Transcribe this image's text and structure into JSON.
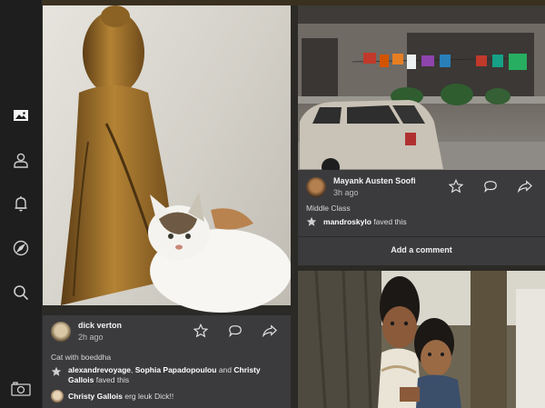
{
  "colors": {
    "sidebar_bg": "#1e1e1f",
    "card_bg": "#3b3b3e",
    "text_primary": "#f2f2f2",
    "text_secondary": "#bdbdbd"
  },
  "sidebar": {
    "items": [
      {
        "icon": "photos-icon",
        "active": true
      },
      {
        "icon": "profile-icon",
        "active": false
      },
      {
        "icon": "notifications-bell-icon",
        "active": false
      },
      {
        "icon": "explore-compass-icon",
        "active": false
      },
      {
        "icon": "search-icon",
        "active": false
      },
      {
        "icon": "camera-icon",
        "active": false
      }
    ]
  },
  "feed": {
    "cards": [
      {
        "user": "dick verton",
        "time": "2h ago",
        "caption": "Cat with boeddha",
        "faved_by_1": "alexandrevoyage",
        "faved_sep_1": ", ",
        "faved_by_2": "Sophia Papadopoulou",
        "faved_and": " and ",
        "faved_by_3": "Christy Gallois",
        "faved_suffix": " faved this",
        "comment_user": "Christy Gallois",
        "comment_text": " erg leuk Dick!!"
      },
      {
        "user": "Mayank Austen Soofi",
        "time": "3h ago",
        "caption": "Middle Class",
        "faved_by_1": "mandroskylo",
        "faved_suffix": " faved this",
        "add_comment": "Add a comment"
      }
    ]
  }
}
